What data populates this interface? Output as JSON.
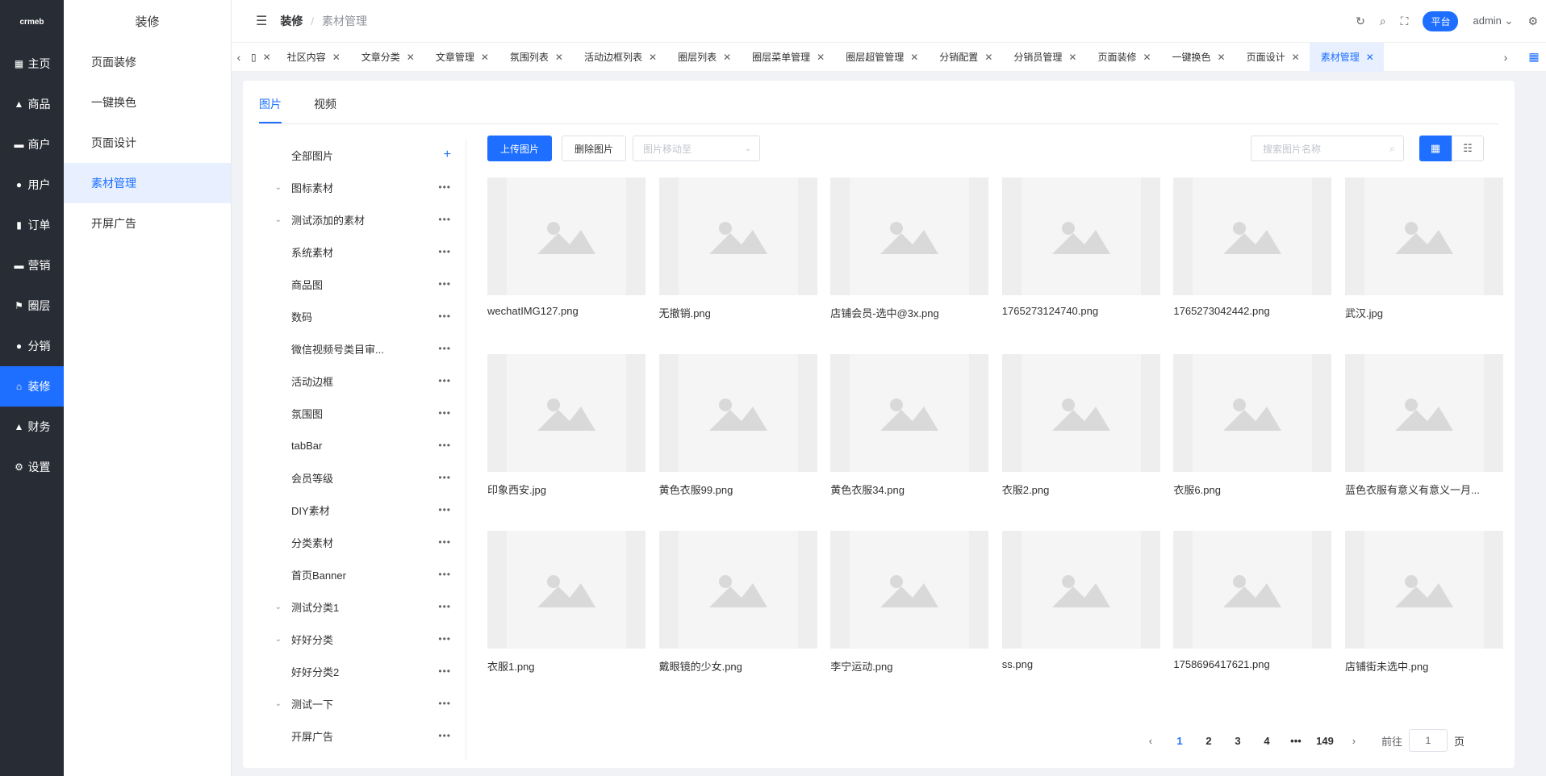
{
  "logo_text": "crmeb",
  "nav": [
    {
      "label": "主页",
      "icon": "grid-icon",
      "glyph": "▦"
    },
    {
      "label": "商品",
      "icon": "bag-icon",
      "glyph": "▲"
    },
    {
      "label": "商户",
      "icon": "store-icon",
      "glyph": "▬"
    },
    {
      "label": "用户",
      "icon": "user-icon",
      "glyph": "●"
    },
    {
      "label": "订单",
      "icon": "order-icon",
      "glyph": "▮"
    },
    {
      "label": "营销",
      "icon": "chart-icon",
      "glyph": "▬"
    },
    {
      "label": "圈层",
      "icon": "flag-icon",
      "glyph": "⚑"
    },
    {
      "label": "分销",
      "icon": "person-icon",
      "glyph": "●"
    },
    {
      "label": "装修",
      "icon": "home-icon",
      "glyph": "⌂",
      "active": true
    },
    {
      "label": "财务",
      "icon": "finance-icon",
      "glyph": "▲"
    },
    {
      "label": "设置",
      "icon": "gear-icon",
      "glyph": "⚙"
    }
  ],
  "submenu": {
    "title": "装修",
    "items": [
      "页面装修",
      "一键换色",
      "页面设计",
      "素材管理",
      "开屏广告"
    ],
    "active_index": 3
  },
  "header": {
    "breadcrumb": [
      "装修",
      "素材管理"
    ],
    "platform_label": "平台",
    "user": "admin"
  },
  "tabs": [
    {
      "label": "社区内容"
    },
    {
      "label": "文章分类"
    },
    {
      "label": "文章管理"
    },
    {
      "label": "氛围列表"
    },
    {
      "label": "活动边框列表"
    },
    {
      "label": "圈层列表"
    },
    {
      "label": "圈层菜单管理"
    },
    {
      "label": "圈层超管管理"
    },
    {
      "label": "分销配置"
    },
    {
      "label": "分销员管理"
    },
    {
      "label": "页面装修"
    },
    {
      "label": "一键换色"
    },
    {
      "label": "页面设计"
    },
    {
      "label": "素材管理",
      "active": true
    }
  ],
  "content_tabs": {
    "image": "图片",
    "video": "视频"
  },
  "tree": [
    {
      "label": "全部图片",
      "caret": false,
      "action": "plus"
    },
    {
      "label": "图标素材",
      "caret": true
    },
    {
      "label": "测试添加的素材",
      "caret": true
    },
    {
      "label": "系统素材",
      "caret": false
    },
    {
      "label": "商品图",
      "caret": false
    },
    {
      "label": "数码",
      "caret": false
    },
    {
      "label": "微信视频号类目审...",
      "caret": false
    },
    {
      "label": "活动边框",
      "caret": false
    },
    {
      "label": "氛围图",
      "caret": false
    },
    {
      "label": "tabBar",
      "caret": false
    },
    {
      "label": "会员等级",
      "caret": false
    },
    {
      "label": "DIY素材",
      "caret": false
    },
    {
      "label": "分类素材",
      "caret": false
    },
    {
      "label": "首页Banner",
      "caret": false
    },
    {
      "label": "测试分类1",
      "caret": true
    },
    {
      "label": "好好分类",
      "caret": true
    },
    {
      "label": "好好分类2",
      "caret": false
    },
    {
      "label": "测试一下",
      "caret": true
    },
    {
      "label": "开屏广告",
      "caret": false
    }
  ],
  "toolbar": {
    "upload": "上传图片",
    "delete": "删除图片",
    "move_placeholder": "图片移动至",
    "search_placeholder": "搜索图片名称"
  },
  "images": [
    "wechatIMG127.png",
    "无撤销.png",
    "店铺会员-选中@3x.png",
    "1765273124740.png",
    "1765273042442.png",
    "武汉.jpg",
    "印象西安.jpg",
    "黄色衣服99.png",
    "黄色衣服34.png",
    "衣服2.png",
    "衣服6.png",
    "蓝色衣服有意义有意义一月...",
    "衣服1.png",
    "戴眼镜的少女.png",
    "李宁运动.png",
    "ss.png",
    "1758696417621.png",
    "店铺街未选中.png"
  ],
  "pagination": {
    "pages": [
      "1",
      "2",
      "3",
      "4",
      "•••",
      "149"
    ],
    "active": "1",
    "goto_label": "前往",
    "goto_value": "1",
    "page_suffix": "页"
  },
  "colors": {
    "accent": "#1e6fff",
    "nav_bg": "#282c34"
  }
}
